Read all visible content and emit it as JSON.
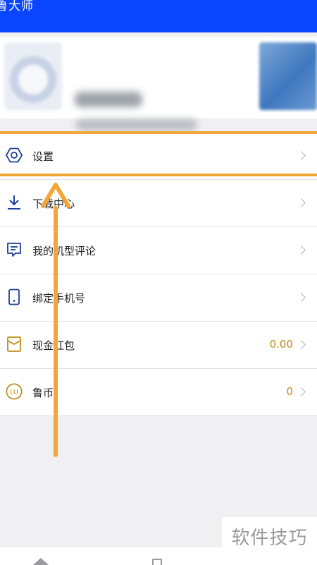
{
  "header": {
    "title": "鲁大师"
  },
  "menu": {
    "items": [
      {
        "label": "设置",
        "icon": "settings-hexagon-icon"
      },
      {
        "label": "下载中心",
        "icon": "download-icon"
      },
      {
        "label": "我的机型评论",
        "icon": "comment-icon"
      },
      {
        "label": "绑定手机号",
        "icon": "phone-icon"
      },
      {
        "label": "现金红包",
        "icon": "red-envelope-icon",
        "value": "0.00"
      },
      {
        "label": "鲁币",
        "icon": "lu-coin-icon",
        "value": "0"
      }
    ]
  },
  "watermark": {
    "text": "软件技巧"
  },
  "colors": {
    "header": "#0a45ff",
    "accent": "#f2a638",
    "icon_blue": "#1f3f9a",
    "icon_gold": "#c18a18"
  }
}
